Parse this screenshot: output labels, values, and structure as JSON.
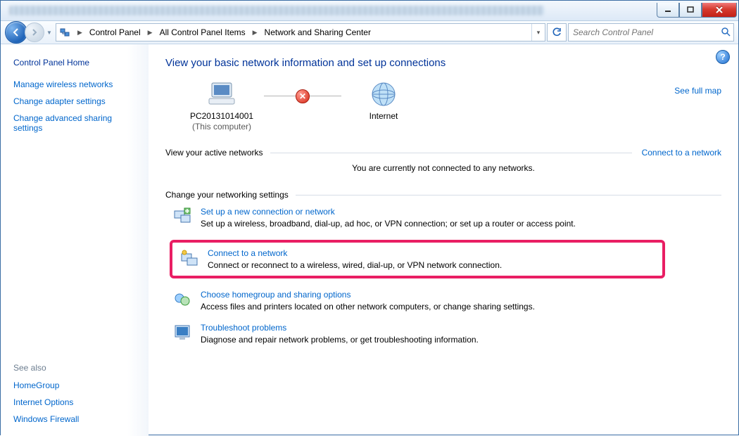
{
  "breadcrumb": {
    "root": "Control Panel",
    "mid": "All Control Panel Items",
    "leaf": "Network and Sharing Center"
  },
  "search": {
    "placeholder": "Search Control Panel"
  },
  "sidebar": {
    "home": "Control Panel Home",
    "links": {
      "wireless": "Manage wireless networks",
      "adapter": "Change adapter settings",
      "advanced": "Change advanced sharing settings"
    },
    "see_also_label": "See also",
    "see_also": {
      "homegroup": "HomeGroup",
      "inetopt": "Internet Options",
      "firewall": "Windows Firewall"
    }
  },
  "main": {
    "heading": "View your basic network information and set up connections",
    "full_map": "See full map",
    "node_pc": {
      "name": "PC20131014001",
      "sub": "(This computer)"
    },
    "node_net": {
      "name": "Internet"
    },
    "active_label": "View your active networks",
    "connect_link": "Connect to a network",
    "not_connected": "You are currently not connected to any networks.",
    "change_label": "Change your networking settings",
    "tasks": {
      "setup": {
        "title": "Set up a new connection or network",
        "desc": "Set up a wireless, broadband, dial-up, ad hoc, or VPN connection; or set up a router or access point."
      },
      "connect": {
        "title": "Connect to a network",
        "desc": "Connect or reconnect to a wireless, wired, dial-up, or VPN network connection."
      },
      "home": {
        "title": "Choose homegroup and sharing options",
        "desc": "Access files and printers located on other network computers, or change sharing settings."
      },
      "trouble": {
        "title": "Troubleshoot problems",
        "desc": "Diagnose and repair network problems, or get troubleshooting information."
      }
    }
  }
}
